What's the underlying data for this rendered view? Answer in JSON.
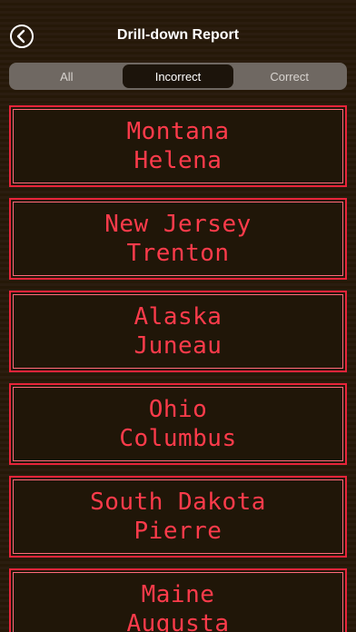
{
  "navbar": {
    "title": "Drill-down Report",
    "back_icon": "chevron-left-circle-icon"
  },
  "segments": [
    {
      "label": "All",
      "selected": false
    },
    {
      "label": "Incorrect",
      "selected": true
    },
    {
      "label": "Correct",
      "selected": false
    }
  ],
  "items": [
    {
      "state": "Montana",
      "capital": "Helena"
    },
    {
      "state": "New Jersey",
      "capital": "Trenton"
    },
    {
      "state": "Alaska",
      "capital": "Juneau"
    },
    {
      "state": "Ohio",
      "capital": "Columbus"
    },
    {
      "state": "South Dakota",
      "capital": "Pierre"
    },
    {
      "state": "Maine",
      "capital": "Augusta"
    }
  ],
  "colors": {
    "background": "#2a1c0e",
    "card_border": "#e8243a",
    "card_text": "#ff3b4b",
    "segment_bg": "#6f6862",
    "segment_selected_bg": "#1c140b"
  }
}
